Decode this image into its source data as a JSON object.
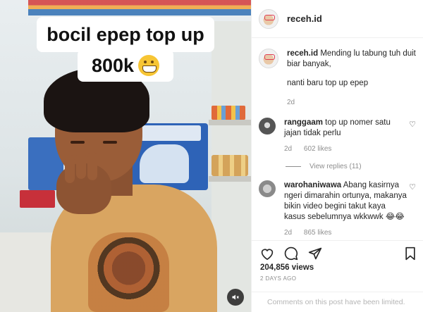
{
  "media": {
    "caption_line1": "bocil epep top up",
    "caption_line2": "800k"
  },
  "post": {
    "username": "receh.id"
  },
  "caption_comment": {
    "user": "receh.id",
    "text": "Mending lu tabung tuh duit biar banyak,",
    "text2": "nanti baru top up epep",
    "time": "2d"
  },
  "comments": [
    {
      "user": "ranggaam",
      "text": "top up nomer satu jajan tidak perlu",
      "time": "2d",
      "likes": "602 likes",
      "view_replies": "View replies (11)"
    },
    {
      "user": "warohaniwawa",
      "text": "Abang kasirnya ngeri dimarahin ortunya, makanya bikin video begini takut kaya kasus sebelumnya wkkwwk",
      "emoji": "😂😂",
      "time": "2d",
      "likes": "865 likes"
    }
  ],
  "stats": {
    "views": "204,856 views",
    "ago": "2 DAYS AGO"
  },
  "footer": {
    "limited": "Comments on this post have been limited."
  },
  "icons": [
    "heart-icon",
    "comment-icon",
    "share-icon",
    "bookmark-icon",
    "mute-icon"
  ]
}
